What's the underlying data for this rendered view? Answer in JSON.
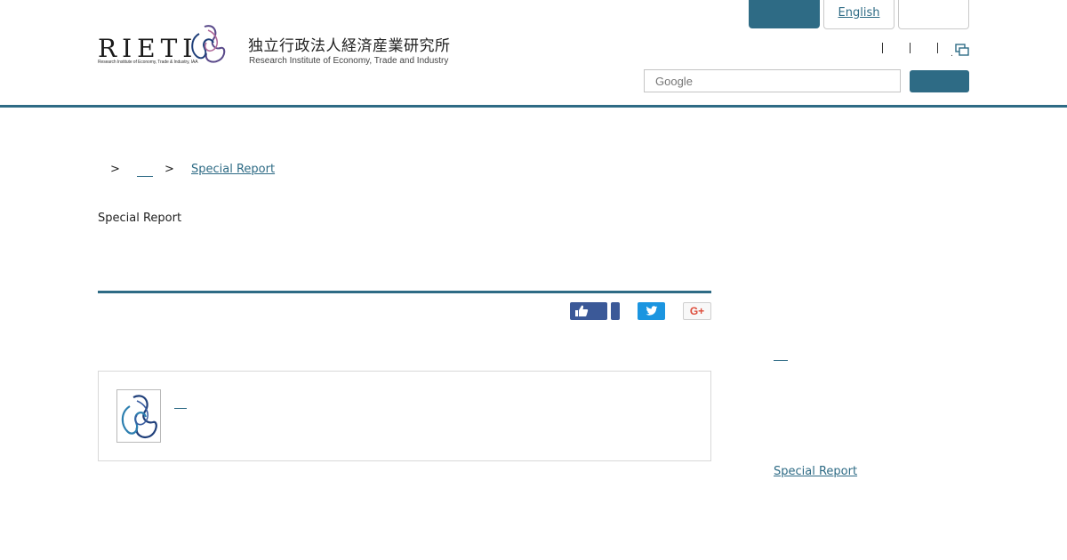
{
  "header": {
    "logo": {
      "wordmark": "RIETI",
      "tagline": "Research Institute of Economy, Trade & Industry, IAA"
    },
    "org_name_ja": "独立行政法人経済産業研究所",
    "org_name_en": "Research Institute of Economy, Trade and Industry",
    "top_buttons": {
      "primary_label": "",
      "english_label": "English",
      "third_label": ""
    },
    "search": {
      "placeholder": "Google",
      "button_label": ""
    }
  },
  "breadcrumb": {
    "separator": ">",
    "items": [
      {
        "label": ""
      },
      {
        "label": "Special Report"
      }
    ]
  },
  "page": {
    "title": "Special Report"
  },
  "social": {
    "googleplus_label": "G+"
  },
  "sidebar": {
    "link_bottom": "Special Report"
  },
  "colors": {
    "accent": "#2e6b85",
    "facebook": "#3b5998",
    "twitter": "#1b95e0",
    "googleplus_text": "#dd4b39"
  }
}
